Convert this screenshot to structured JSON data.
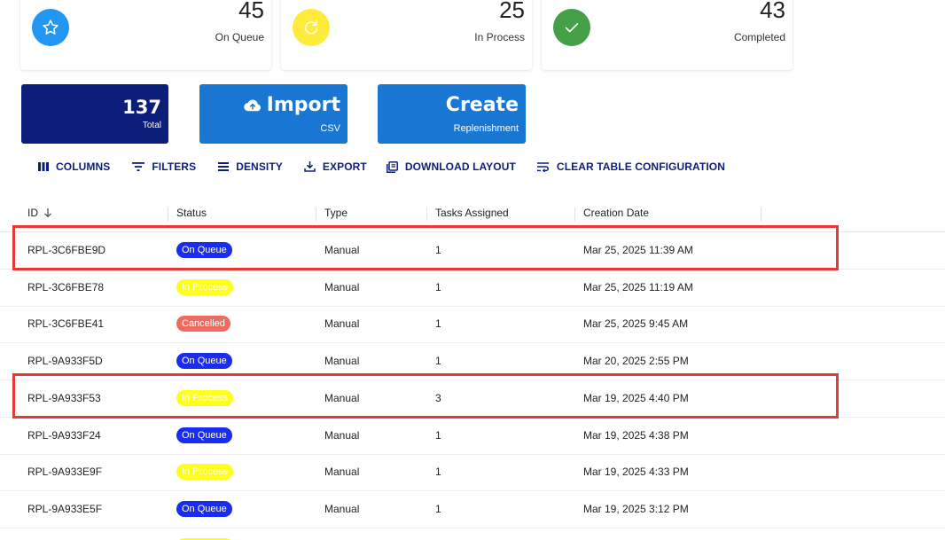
{
  "stats": [
    {
      "value": "45",
      "label": "On Queue",
      "icon": "star-icon",
      "icon_color": "#2196f3"
    },
    {
      "value": "25",
      "label": "In Process",
      "icon": "refresh-icon",
      "icon_color": "#ffeb3b"
    },
    {
      "value": "43",
      "label": "Completed",
      "icon": "check-icon",
      "icon_color": "#43a047"
    }
  ],
  "tiles": {
    "total": {
      "value": "137",
      "label": "Total",
      "color": "#0d1e7a"
    },
    "import": {
      "title": "Import",
      "subtitle": "CSV",
      "icon": "cloud-upload-icon",
      "color": "#1976d2"
    },
    "create": {
      "title": "Create",
      "subtitle": "Replenishment",
      "color": "#1976d2"
    }
  },
  "toolbar": {
    "columns": "COLUMNS",
    "filters": "FILTERS",
    "density": "DENSITY",
    "export": "EXPORT",
    "download_layout": "DOWNLOAD LAYOUT",
    "clear_config": "CLEAR TABLE CONFIGURATION"
  },
  "table": {
    "headers": {
      "id": "ID",
      "status": "Status",
      "type": "Type",
      "tasks": "Tasks Assigned",
      "date": "Creation Date"
    },
    "sort": {
      "column": "ID",
      "direction": "descending",
      "icon": "arrow-down-icon"
    },
    "status_colors": {
      "On Queue": {
        "bg": "#1a2cf0",
        "fg": "#ffffff"
      },
      "In Process": {
        "bg": "#ffff1e",
        "fg": "#ffffff"
      },
      "Cancelled": {
        "bg": "#f06a60",
        "fg": "#ffffff"
      }
    },
    "rows": [
      {
        "id": "RPL-3C6FBE9D",
        "status": "On Queue",
        "type": "Manual",
        "tasks": "1",
        "date": "Mar 25, 2025 11:39 AM",
        "highlighted": true
      },
      {
        "id": "RPL-3C6FBE78",
        "status": "In Process",
        "type": "Manual",
        "tasks": "1",
        "date": "Mar 25, 2025 11:19 AM",
        "highlighted": false
      },
      {
        "id": "RPL-3C6FBE41",
        "status": "Cancelled",
        "type": "Manual",
        "tasks": "1",
        "date": "Mar 25, 2025 9:45 AM",
        "highlighted": false
      },
      {
        "id": "RPL-9A933F5D",
        "status": "On Queue",
        "type": "Manual",
        "tasks": "1",
        "date": "Mar 20, 2025 2:55 PM",
        "highlighted": false
      },
      {
        "id": "RPL-9A933F53",
        "status": "In Process",
        "type": "Manual",
        "tasks": "3",
        "date": "Mar 19, 2025 4:40 PM",
        "highlighted": true
      },
      {
        "id": "RPL-9A933F24",
        "status": "On Queue",
        "type": "Manual",
        "tasks": "1",
        "date": "Mar 19, 2025 4:38 PM",
        "highlighted": false
      },
      {
        "id": "RPL-9A933E9F",
        "status": "In Process",
        "type": "Manual",
        "tasks": "1",
        "date": "Mar 19, 2025 4:33 PM",
        "highlighted": false
      },
      {
        "id": "RPL-9A933E5F",
        "status": "On Queue",
        "type": "Manual",
        "tasks": "1",
        "date": "Mar 19, 2025 3:12 PM",
        "highlighted": false
      },
      {
        "id": "",
        "status": "In Process",
        "type": "",
        "tasks": "",
        "date": "",
        "highlighted": false
      }
    ]
  }
}
